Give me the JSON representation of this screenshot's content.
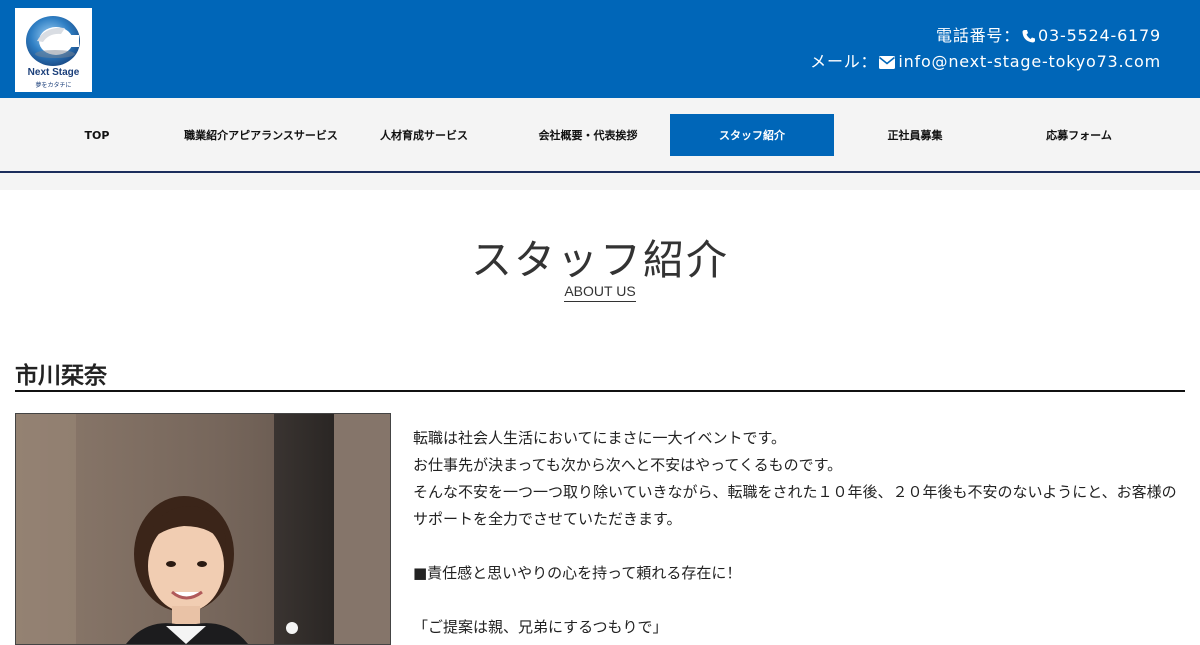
{
  "header": {
    "logo_text": "Next Stage",
    "logo_tagline": "夢をカタチに",
    "phone_label": "電話番号：",
    "phone_number": "03-5524-6179",
    "mail_label": "メール：",
    "email": "info@next-stage-tokyo73.com",
    "brand_color": "#0066b8"
  },
  "nav": {
    "items": [
      {
        "label": "TOP",
        "active": false
      },
      {
        "label": "職業紹介アピアランスサービス",
        "active": false
      },
      {
        "label": "人材育成サービス",
        "active": false
      },
      {
        "label": "会社概要・代表挨拶",
        "active": false
      },
      {
        "label": "スタッフ紹介",
        "active": true
      },
      {
        "label": "正社員募集",
        "active": false
      },
      {
        "label": "応募フォーム",
        "active": false
      }
    ]
  },
  "page": {
    "title": "スタッフ紹介",
    "subtitle": "ABOUT US"
  },
  "staff": {
    "name": "市川栞奈",
    "bio": [
      "転職は社会人生活においてにまさに一大イベントです。",
      "お仕事先が決まっても次から次へと不安はやってくるものです。",
      "そんな不安を一つ一つ取り除いていきながら、転職をされた１０年後、２０年後も不安のないようにと、お客様のサポートを全力でさせていただきます。",
      "■責任感と思いやりの心を持って頼れる存在に！",
      "「ご提案は親、兄弟にするつもりで」"
    ]
  }
}
